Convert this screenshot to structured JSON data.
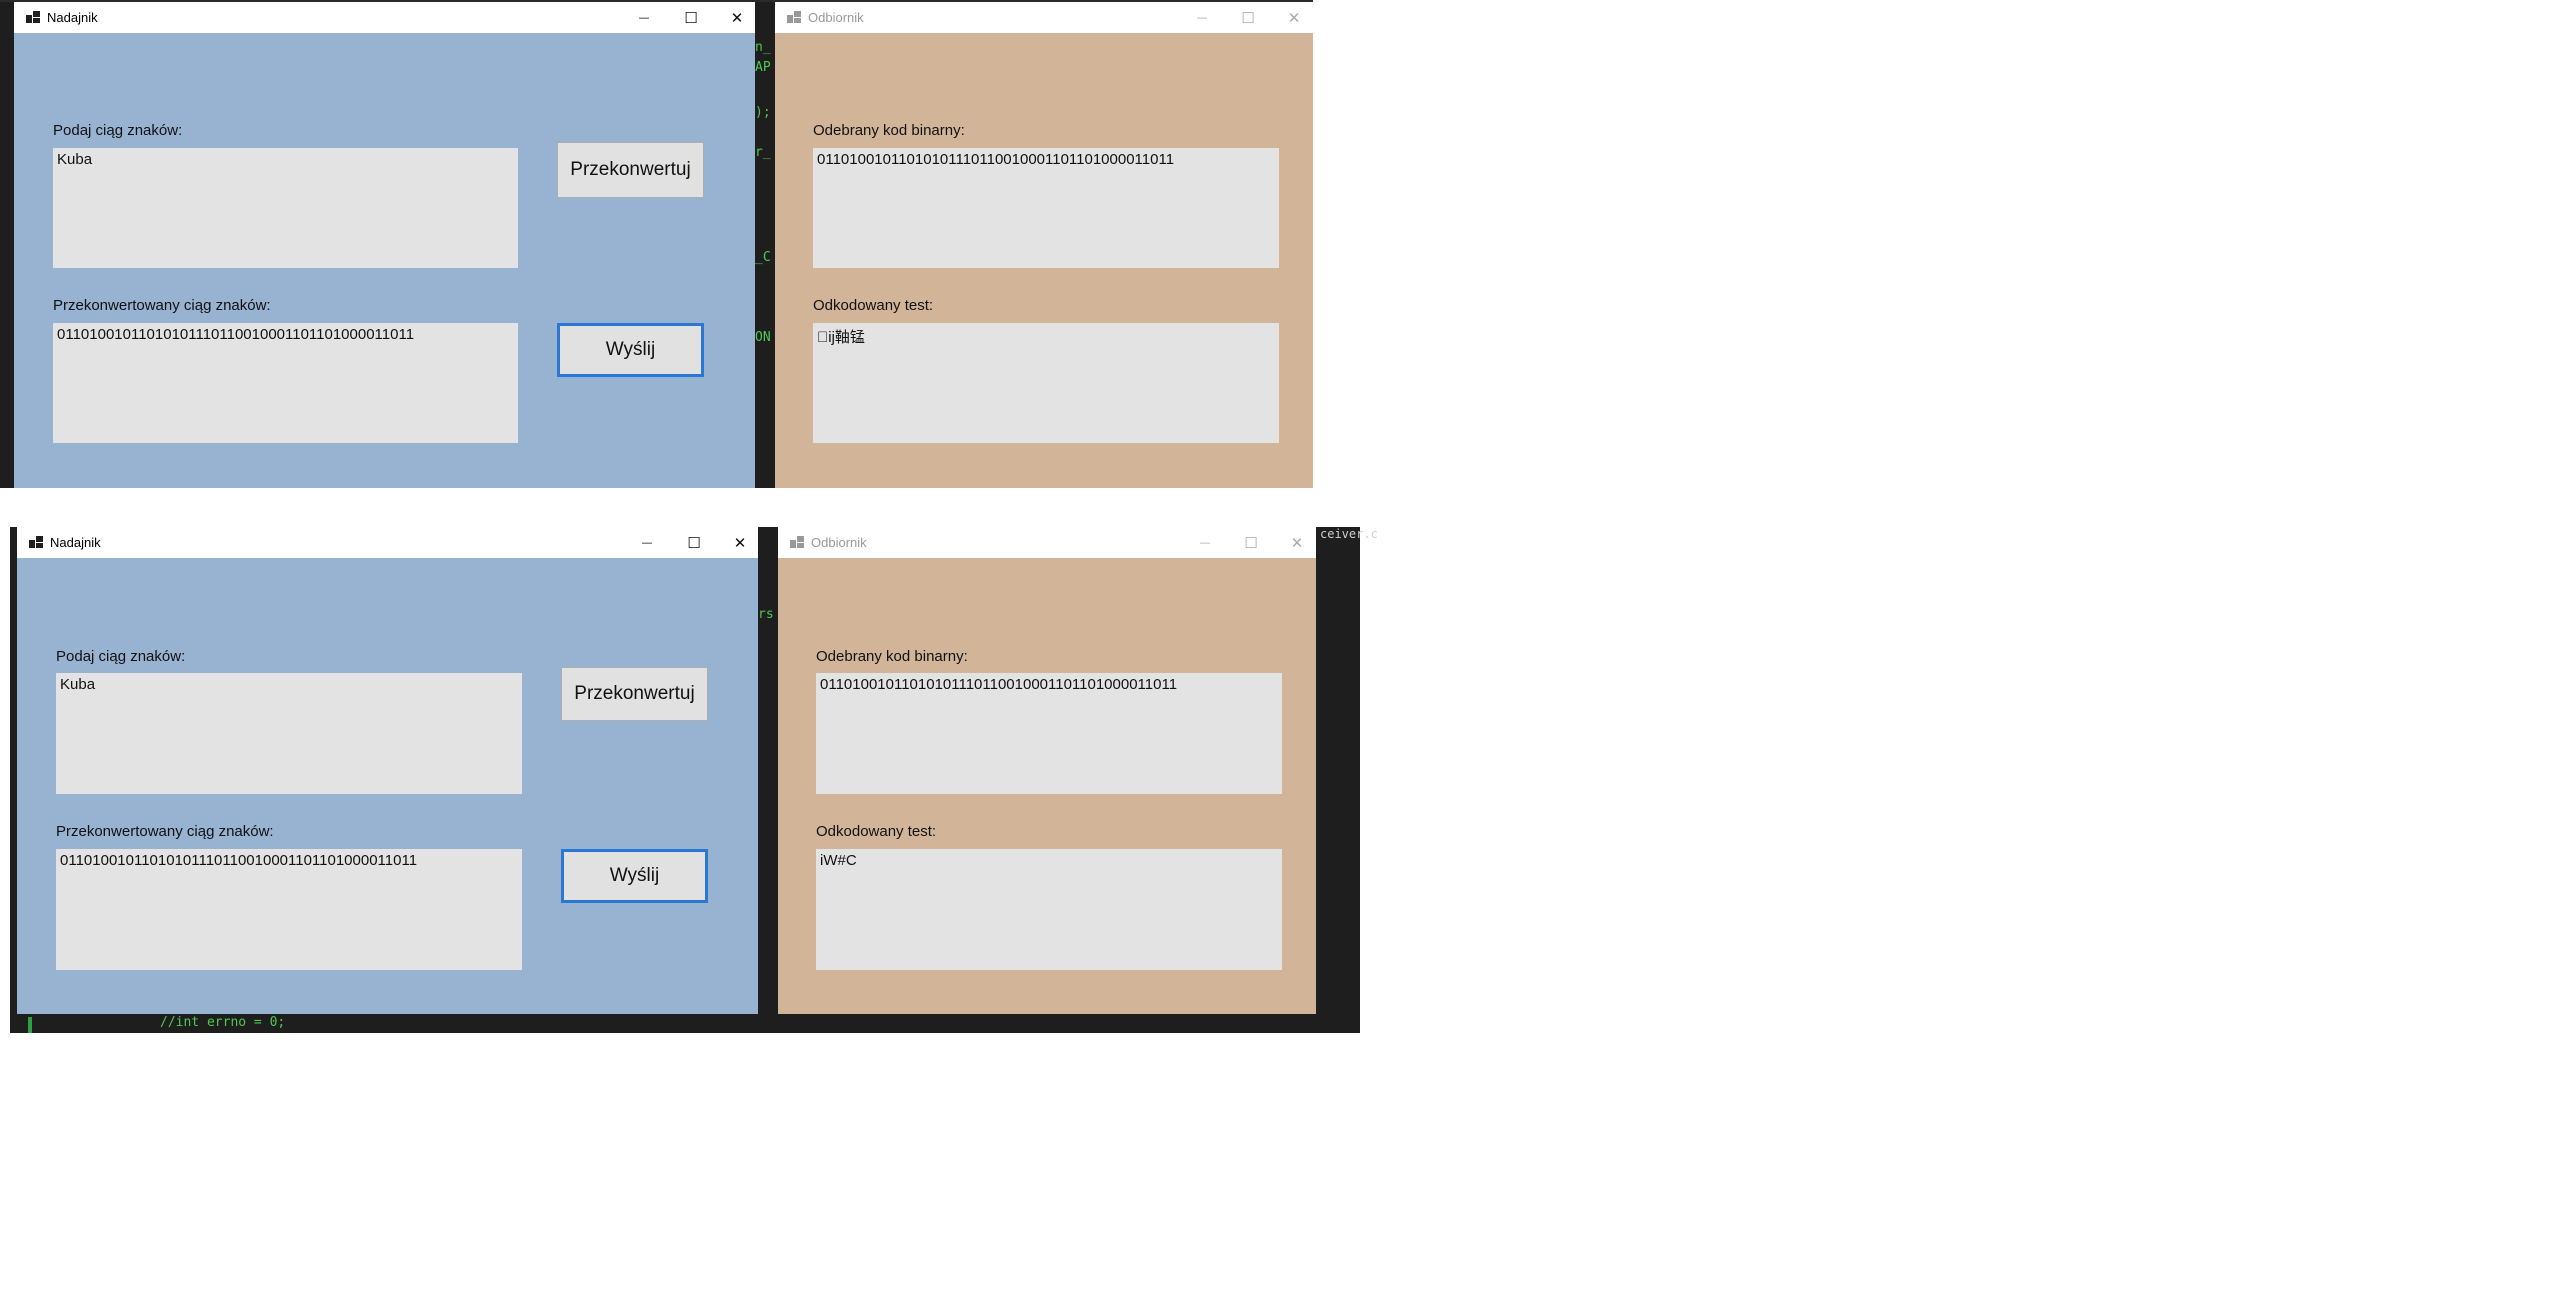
{
  "top_pair": {
    "sender": {
      "title": "Nadajnik",
      "input_label": "Podaj ciąg znaków:",
      "input_value": "Kuba",
      "convert_button": "Przekonwertuj",
      "output_label": "Przekonwertowany ciąg znaków:",
      "output_value": "01101001011010101110110010001101101000011011",
      "send_button": "Wyślij"
    },
    "receiver": {
      "title": "Odbiornik",
      "binary_label": "Odebrany kod binarny:",
      "binary_value": "01101001011010101110110010001101101000011011",
      "decoded_label": "Odkodowany test:",
      "decoded_value": "\u0000ĳ䩜锰"
    }
  },
  "bottom_pair": {
    "sender": {
      "title": "Nadajnik",
      "input_label": "Podaj ciąg znaków:",
      "input_value": "Kuba",
      "convert_button": "Przekonwertuj",
      "output_label": "Przekonwertowany ciąg znaków:",
      "output_value": "01101001011010101110110010001101101000011011",
      "send_button": "Wyślij"
    },
    "receiver": {
      "title": "Odbiornik",
      "binary_label": "Odebrany kod binarny:",
      "binary_value": "01101001011010101110110010001101101000011011",
      "decoded_label": "Odkodowany test:",
      "decoded_value": "iW#C"
    }
  },
  "window_controls": {
    "minimize": "—",
    "maximize": "☐",
    "close": "✕"
  },
  "background_code": {
    "right_edge_text": "ceiver.c",
    "bottom_line": "//int errno = 0;"
  },
  "colors": {
    "sender_bg": "#98b3d2",
    "receiver_bg": "#d2b598",
    "editor_bg": "#1e1e1e",
    "accent": "#2a78d4"
  }
}
